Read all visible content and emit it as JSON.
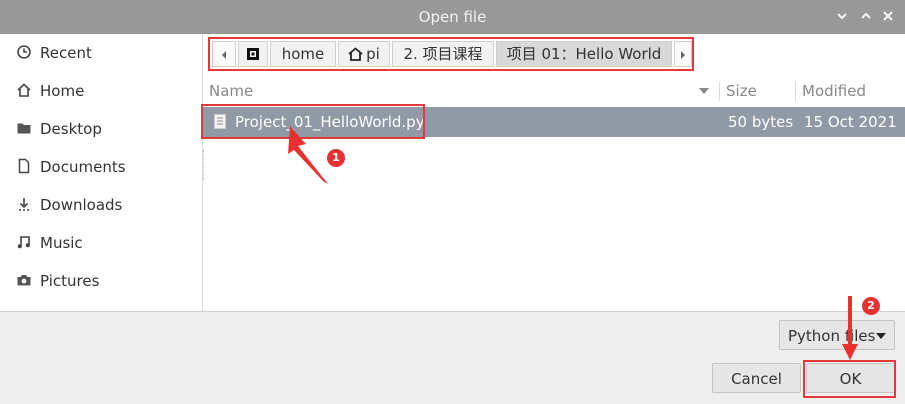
{
  "window": {
    "title": "Open file"
  },
  "sidebar": {
    "items": [
      {
        "label": "Recent",
        "icon": "clock-icon"
      },
      {
        "label": "Home",
        "icon": "home-icon"
      },
      {
        "label": "Desktop",
        "icon": "folder-icon"
      },
      {
        "label": "Documents",
        "icon": "document-icon"
      },
      {
        "label": "Downloads",
        "icon": "download-icon"
      },
      {
        "label": "Music",
        "icon": "music-icon"
      },
      {
        "label": "Pictures",
        "icon": "camera-icon"
      }
    ]
  },
  "pathbar": {
    "segments": [
      "home",
      "pi",
      "2. 项目课程",
      "项目 01：Hello World"
    ]
  },
  "filelist": {
    "columns": [
      "Name",
      "Size",
      "Modified"
    ],
    "rows": [
      {
        "name": "Project_01_HelloWorld.py",
        "size": "50 bytes",
        "modified": "15 Oct 2021"
      }
    ]
  },
  "footer": {
    "filter_label": "Python files",
    "cancel_label": "Cancel",
    "ok_label": "OK"
  },
  "annotations": {
    "badge1": "1",
    "badge2": "2"
  },
  "colors": {
    "accent_red": "#e23a3a",
    "selection": "#8f9aa6",
    "titlebar": "#989898"
  }
}
